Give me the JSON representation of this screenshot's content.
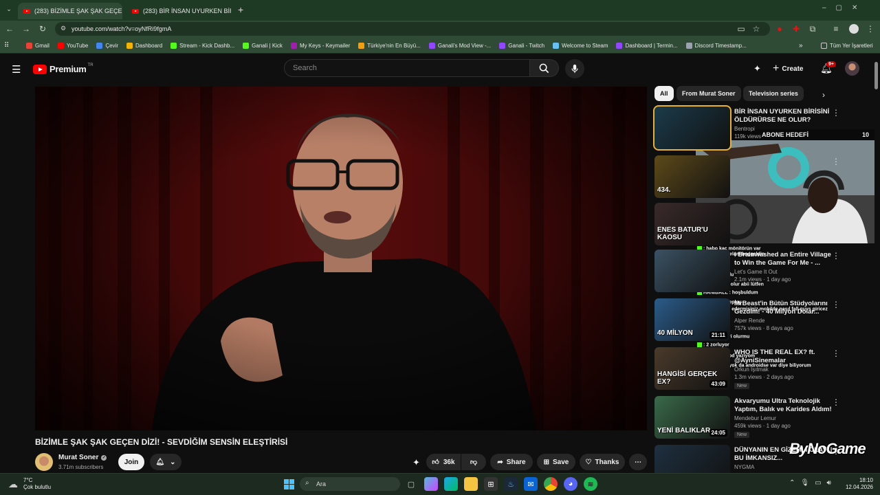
{
  "browser": {
    "tabs": [
      {
        "label": "(283) BİZİMLE ŞAK ŞAK GEÇEN D"
      },
      {
        "label": "(283) BİR İNSAN UYURKEN BİRİ"
      }
    ],
    "new_tab": "+",
    "url": "youtube.com/watch?v=oyNfRi9fgmA",
    "bookmarks": [
      {
        "label": "Gmail",
        "color": "#ea4335"
      },
      {
        "label": "YouTube",
        "color": "#ff0000"
      },
      {
        "label": "Çevir",
        "color": "#4285f4"
      },
      {
        "label": "Dashboard",
        "color": "#f4b400"
      },
      {
        "label": "Stream - Kick Dashb...",
        "color": "#53fc18"
      },
      {
        "label": "Ganali | Kick",
        "color": "#53fc18"
      },
      {
        "label": "My Keys - Keymailer",
        "color": "#a21caf"
      },
      {
        "label": "Türkiye'nin En Büyü...",
        "color": "#f59e0b"
      },
      {
        "label": "Ganali's Mod View -...",
        "color": "#9146ff"
      },
      {
        "label": "Ganali - Twitch",
        "color": "#9146ff"
      },
      {
        "label": "Welcome to Steam",
        "color": "#66c0f4"
      },
      {
        "label": "Dashboard | Termin...",
        "color": "#9146ff"
      },
      {
        "label": "Discord Timestamp...",
        "color": "#9ca3af"
      }
    ],
    "all_bookmarks": "Tüm Yer İşaretleri"
  },
  "youtube": {
    "logo": "Premium",
    "region": "TR",
    "search_placeholder": "Search",
    "create_label": "Create",
    "notif_badge": "9+",
    "video": {
      "title": "BİZİMLE ŞAK ŞAK GEÇEN DİZİ! - SEVDİĞİM SENSİN ELEŞTİRİSİ",
      "channel": "Murat Soner",
      "subscribers": "3.71m subscribers",
      "join_label": "Join",
      "likes": "36k",
      "share_label": "Share",
      "save_label": "Save",
      "thanks_label": "Thanks"
    },
    "chips": [
      "All",
      "From Murat Soner",
      "Television series"
    ],
    "recommendations": [
      {
        "title": "BİR İNSAN UYURKEN BİRİSİNİ ÖLDÜRÜRSE NE OLUR?",
        "channel": "Bentropi",
        "meta": "119k views",
        "thumb": "#1b3b4a"
      },
      {
        "title": "",
        "channel": "",
        "meta": "",
        "thumb": "#5d4a1a",
        "badge": "434."
      },
      {
        "title": "",
        "channel": "",
        "meta": "",
        "thumb": "#3a2a2a",
        "badge": "ENES BATUR'U KAOSU"
      },
      {
        "title": "I Brainwashed an Entire Village to Win the Game For Me - ...",
        "channel": "Let's Game It Out",
        "meta": "2.1m views · 1 day ago",
        "thumb": "#3b5263"
      },
      {
        "title": "MrBeast'in Bütün Stüdyolarını Gezdim! - 40 Milyon Dolar...",
        "channel": "Alper Rende",
        "meta": "757k views · 8 days ago",
        "thumb": "#2b5c8a",
        "badge": "40 MİLYON",
        "duration": "21:11"
      },
      {
        "title": "WHO IS THE REAL EX? ft. @AyniSinemalar",
        "channel": "Orkun Işıtmak",
        "meta": "1.3m views · 2 days ago",
        "thumb": "#4a3b2b",
        "badge": "HANGİSİ GERÇEK EX?",
        "duration": "43:09",
        "new": "New"
      },
      {
        "title": "Akvaryumu Ultra Teknolojik Yaptım, Balık ve Karides Aldım!",
        "channel": "Mendebur Lemur",
        "meta": "459k views · 1 day ago",
        "thumb": "#3a6a4a",
        "badge": "YENİ BALIKLAR",
        "duration": "24:05",
        "new": "New"
      },
      {
        "title": "DÜNYANIN EN GİZEMLİ OLAYI | BU İMKANSIZ...",
        "channel": "NYGMA",
        "meta": "",
        "thumb": "#1e3040"
      }
    ]
  },
  "overlay": {
    "goal_label": "ABONE HEDEFİ",
    "goal_count": "10",
    "goal_progress": "1",
    "watermark": "ByNoGame",
    "chat": [
      ": habo kaç mönitörün var",
      ": aleyküm selam hoşgeldin",
      ": as",
      ": shajfagafr olur abii lütfen",
      ": noldu noldu",
      "HANIBALL : hoşbuldum",
      ": abicim roleplay",
      ": abi yardım edermisiniz mobilde nasıl fall guys giricez",
      ": olur",
      ": maşallah",
      ": 3. alcam iyi olurmu",
      ": 2 zorluyor",
      ": cmdden kod yazıyom",
      ": iphoneda yok da androidse var diye biliyorum"
    ]
  },
  "taskbar": {
    "weather_temp": "7°C",
    "weather_desc": "Çok bulutlu",
    "search_label": "Ara",
    "time": "18:10",
    "date": "12.04.2026"
  }
}
